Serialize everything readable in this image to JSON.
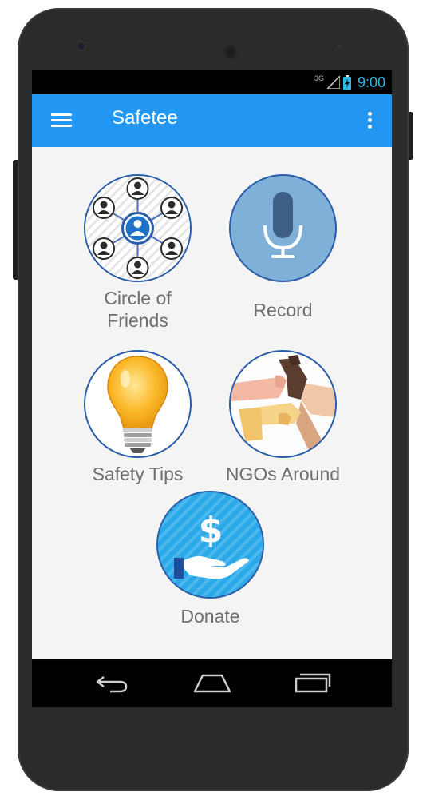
{
  "status_bar": {
    "network": "3G",
    "time": "9:00",
    "time_color": "#33b5e5"
  },
  "app_bar": {
    "title": "Safetee",
    "background": "#2196f3",
    "menu_icon": "hamburger-menu-icon",
    "overflow_icon": "more-vert-icon"
  },
  "tiles": [
    {
      "id": "circle-of-friends",
      "label": "Circle of Friends",
      "icon": "circle-of-friends-icon"
    },
    {
      "id": "record",
      "label": "Record",
      "icon": "microphone-icon"
    },
    {
      "id": "safety-tips",
      "label": "Safety Tips",
      "icon": "light-bulb-icon"
    },
    {
      "id": "ngos-around",
      "label": "NGOs Around",
      "icon": "joined-hands-icon"
    },
    {
      "id": "donate",
      "label": "Donate",
      "icon": "dollar-hand-icon"
    }
  ],
  "navigation_bar": {
    "back": "back-icon",
    "home": "home-icon",
    "recents": "recent-apps-icon"
  },
  "colors": {
    "accent": "#2196f3",
    "circle_border": "#2a5da8",
    "content_background": "#f4f4f4",
    "label_text": "#6e6e6e"
  }
}
